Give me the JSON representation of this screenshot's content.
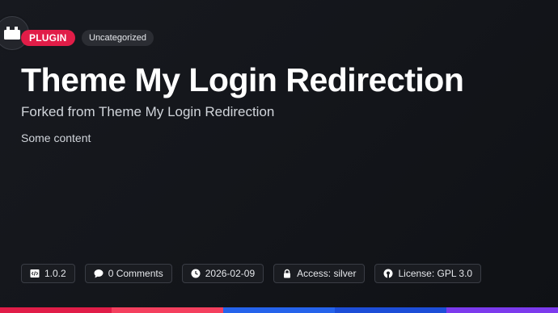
{
  "header": {
    "logo_icon": "plugin-box-icon",
    "badge_label": "PLUGIN",
    "category_label": "Uncategorized"
  },
  "main": {
    "title": "Theme My Login Redirection",
    "subtitle": "Forked from Theme My Login Redirection",
    "content": "Some content"
  },
  "meta": {
    "version": "1.0.2",
    "comments": "0 Comments",
    "date": "2026-02-09",
    "access": "Access: silver",
    "license": "License: GPL 3.0"
  },
  "colors": {
    "accent": "#e11d48",
    "stripe": [
      "#e11d48",
      "#f43f5e",
      "#2563eb",
      "#1d4ed8",
      "#7c3aed"
    ]
  }
}
